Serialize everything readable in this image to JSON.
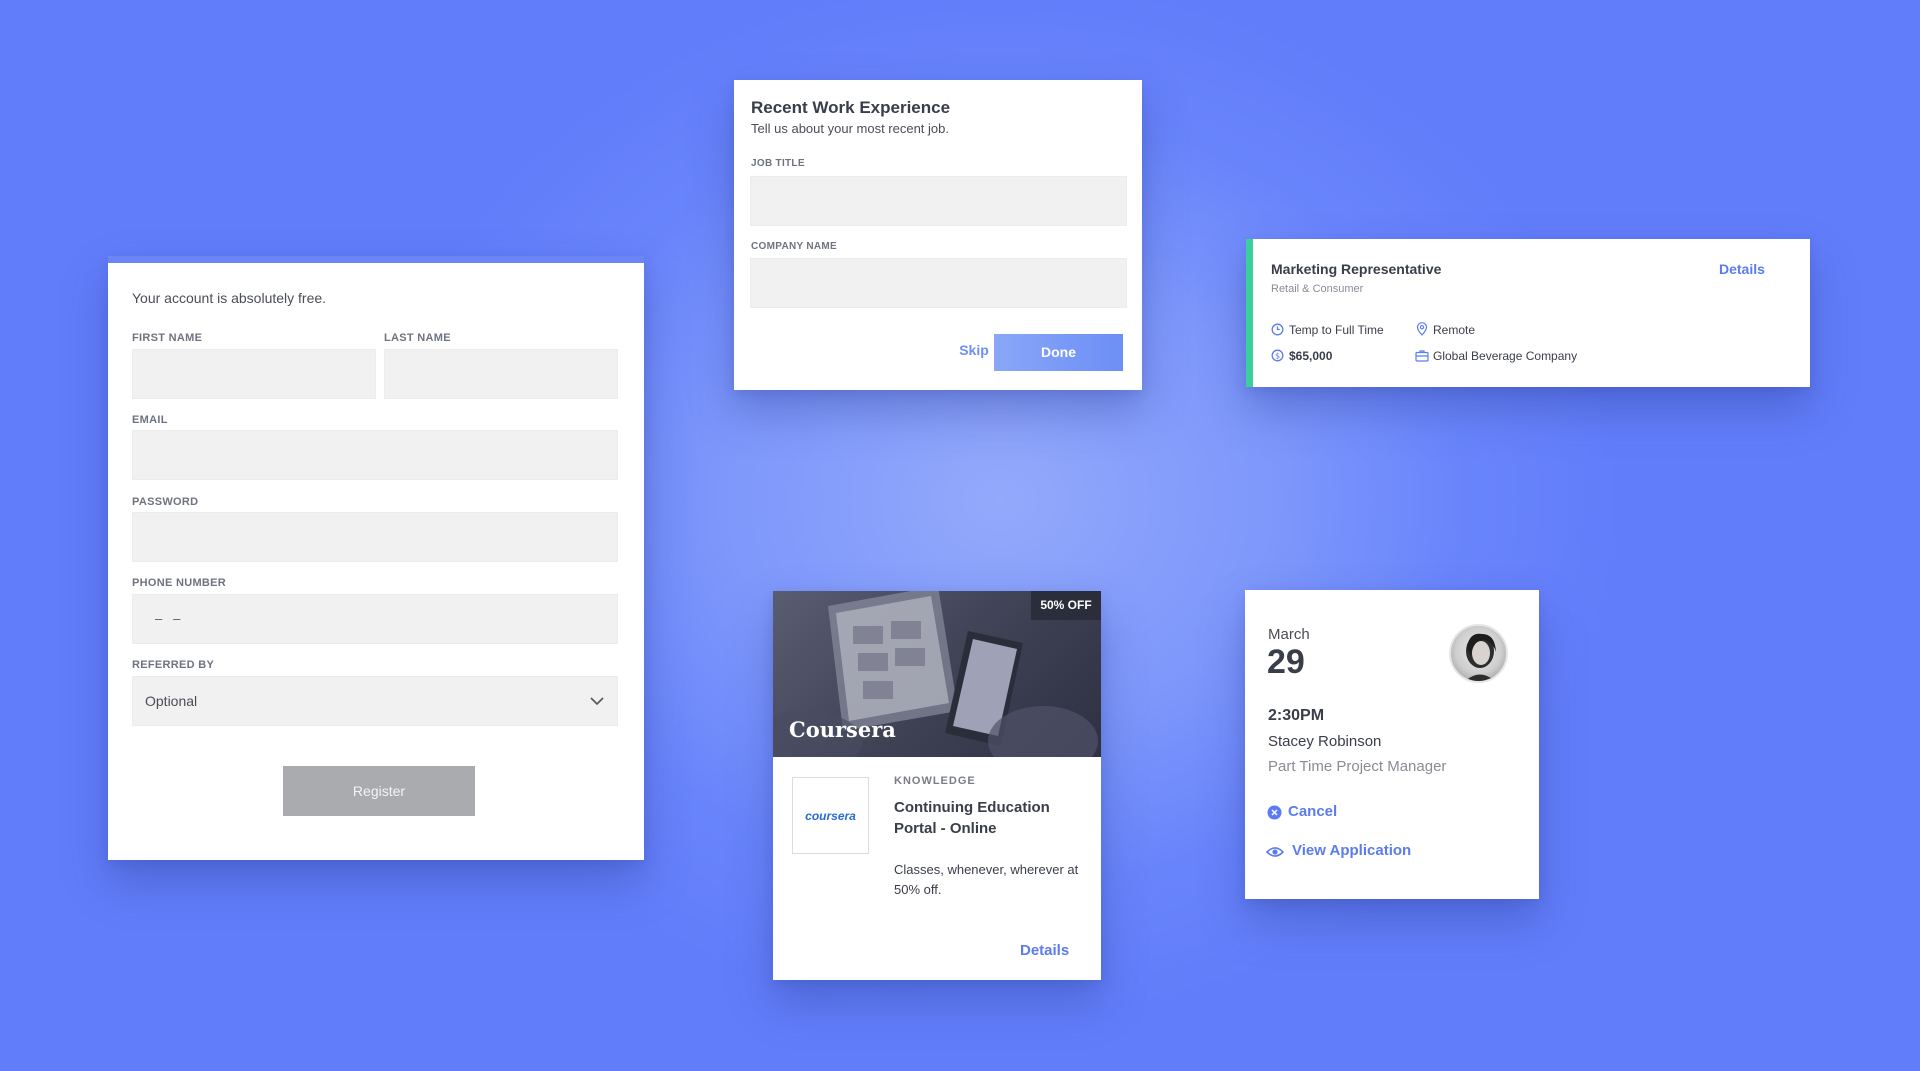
{
  "register": {
    "subtitle": "Your account is absolutely free.",
    "first_name_label": "FIRST NAME",
    "last_name_label": "LAST NAME",
    "email_label": "EMAIL",
    "password_label": "PASSWORD",
    "phone_label": "PHONE NUMBER",
    "phone_value": "–   –",
    "referred_label": "REFERRED BY",
    "referred_value": "Optional",
    "register_button": "Register"
  },
  "work": {
    "title": "Recent Work Experience",
    "subtitle": "Tell us about your most recent job.",
    "job_title_label": "JOB TITLE",
    "company_label": "COMPANY NAME",
    "skip": "Skip",
    "done": "Done"
  },
  "job": {
    "title": "Marketing Representative",
    "category": "Retail & Consumer",
    "details": "Details",
    "employment_type": "Temp to Full Time",
    "location": "Remote",
    "salary": "$65,000",
    "company": "Global Beverage Company",
    "accent_color": "#3ccf9e"
  },
  "course": {
    "badge": "50% OFF",
    "image_brand": "Coursera",
    "logo_text": "coursera",
    "category": "KNOWLEDGE",
    "title": "Continuing Education Portal - Online",
    "description": "Classes, whenever, wherever at 50% off.",
    "details": "Details"
  },
  "appointment": {
    "month": "March",
    "day": "29",
    "time": "2:30PM",
    "name": "Stacey Robinson",
    "role": "Part Time Project Manager",
    "cancel": "Cancel",
    "view": "View Application"
  },
  "colors": {
    "accent_blue": "#5b7cf0",
    "button_blue": "#6e8ff6",
    "register_button_gray": "#a9abaf"
  }
}
